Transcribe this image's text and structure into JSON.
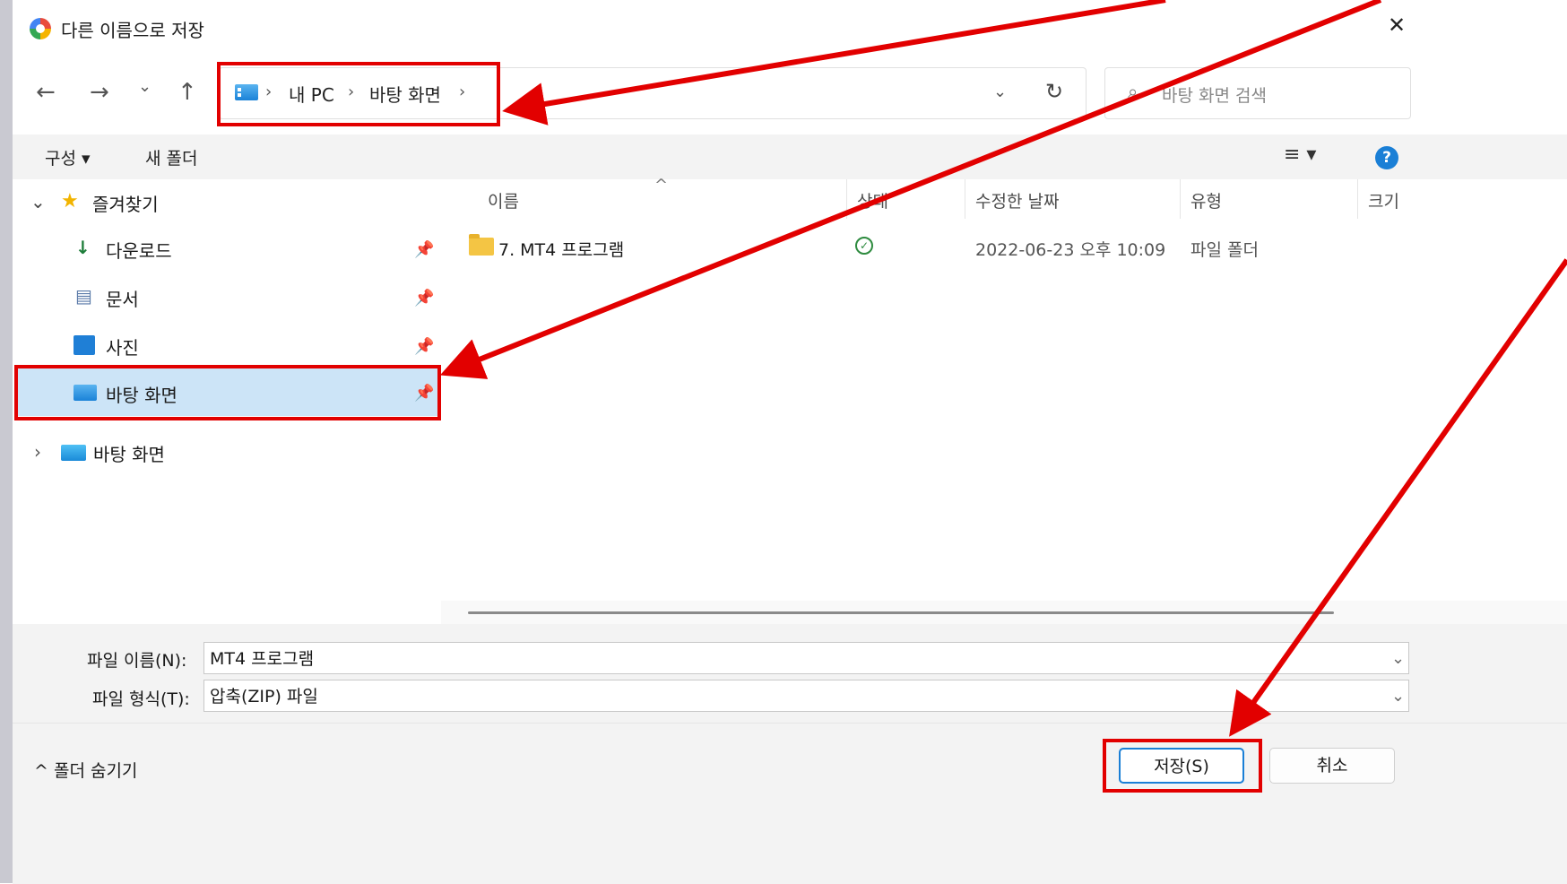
{
  "window": {
    "title": "다른 이름으로 저장",
    "close_glyph": "✕"
  },
  "nav": {
    "back_glyph": "←",
    "forward_glyph": "→",
    "recent_glyph": "⌄",
    "up_glyph": "↑",
    "breadcrumb": [
      "내 PC",
      "바탕 화면"
    ],
    "sep_glyph": "›",
    "address_dropdown_glyph": "⌄",
    "refresh_glyph": "↻",
    "search_placeholder": "바탕 화면 검색",
    "search_glyph": "⌕"
  },
  "commandbar": {
    "organize_label": "구성 ▾",
    "new_folder_label": "새 폴더",
    "view_glyph": "≡ ▾",
    "help_glyph": "?"
  },
  "navpane": {
    "quick_access": {
      "label": "즐겨찾기",
      "expand_glyph": "⌄",
      "star_glyph": "★"
    },
    "pinned": [
      {
        "label": "다운로드",
        "glyph": "↓"
      },
      {
        "label": "문서",
        "glyph": "▤"
      },
      {
        "label": "사진",
        "glyph": "▲"
      },
      {
        "label": "바탕 화면",
        "glyph": ""
      }
    ],
    "pin_glyph": "📌",
    "desktop_root": {
      "label": "바탕 화면",
      "expand_glyph": "›"
    }
  },
  "filelist": {
    "columns": [
      "이름",
      "상태",
      "수정한 날짜",
      "유형",
      "크기"
    ],
    "sort_glyph": "^",
    "rows": [
      {
        "name": "7. MT4 프로그램",
        "status": "✓",
        "modified": "2022-06-23 오후 10:09",
        "type": "파일 폴더",
        "size": ""
      }
    ]
  },
  "fields": {
    "filename_label": "파일 이름(N):",
    "filename_value": "MT4 프로그램",
    "filetype_label": "파일 형식(T):",
    "filetype_value": "압축(ZIP) 파일",
    "dropdown_glyph": "⌄"
  },
  "footer": {
    "hide_folders_label": "^ 폴더 숨기기",
    "save_label": "저장(S)",
    "cancel_label": "취소"
  },
  "colors": {
    "annotation_red": "#e20000",
    "selection_blue": "#cce4f7",
    "accent": "#1a7fd6"
  }
}
